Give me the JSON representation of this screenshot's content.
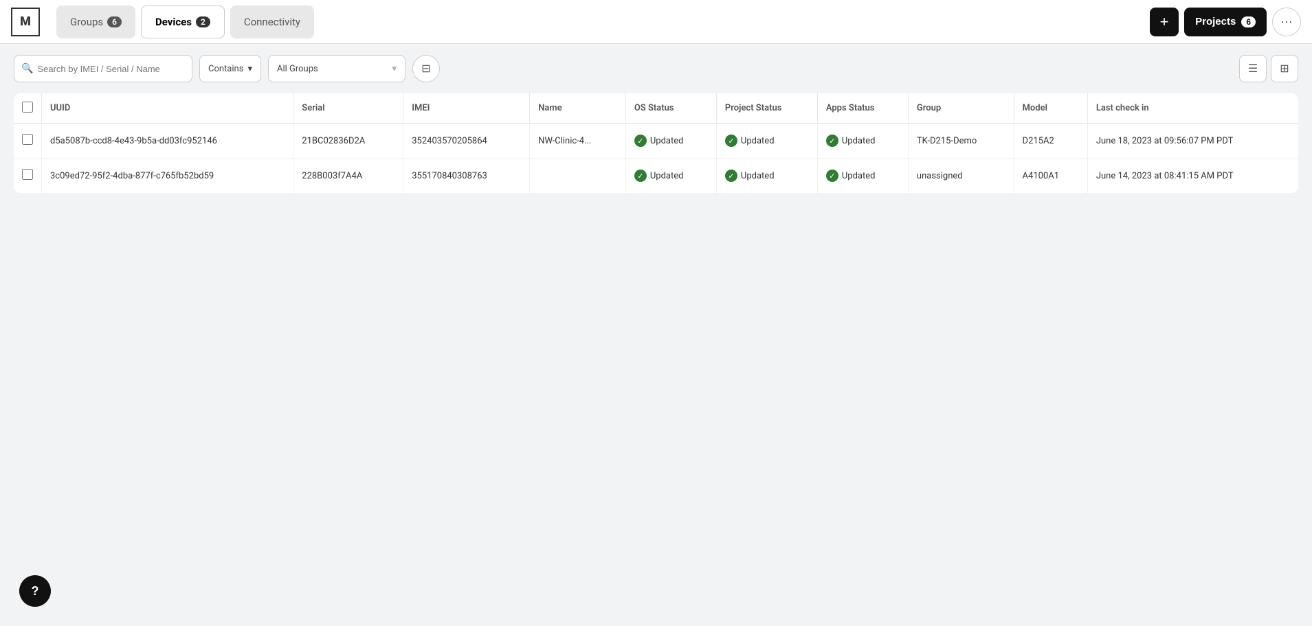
{
  "logo": "M",
  "tabs": [
    {
      "id": "groups",
      "label": "Groups",
      "badge": "6",
      "active": false
    },
    {
      "id": "devices",
      "label": "Devices",
      "badge": "2",
      "active": true
    },
    {
      "id": "connectivity",
      "label": "Connectivity",
      "badge": "",
      "active": false
    }
  ],
  "header": {
    "add_label": "+",
    "projects_label": "Projects",
    "projects_badge": "6",
    "more_dots": "···"
  },
  "toolbar": {
    "search_placeholder": "Search by IMEI / Serial / Name",
    "contains_label": "Contains",
    "all_groups_label": "All Groups",
    "filter_icon": "⊟"
  },
  "table": {
    "columns": [
      "UUID",
      "Serial",
      "IMEI",
      "Name",
      "OS Status",
      "Project Status",
      "Apps Status",
      "Group",
      "Model",
      "Last check in"
    ],
    "rows": [
      {
        "uuid": "d5a5087b-ccd8-4e43-9b5a-dd03fc952146",
        "serial": "21BC02836D2A",
        "imei": "352403570205864",
        "name": "NW-Clinic-4...",
        "os_status": "Updated",
        "project_status": "Updated",
        "apps_status": "Updated",
        "group": "TK-D215-Demo",
        "model": "D215A2",
        "last_check_in": "June 18, 2023 at 09:56:07 PM PDT"
      },
      {
        "uuid": "3c09ed72-95f2-4dba-877f-c765fb52bd59",
        "serial": "228B003f7A4A",
        "imei": "355170840308763",
        "name": "",
        "os_status": "Updated",
        "project_status": "Updated",
        "apps_status": "Updated",
        "group": "unassigned",
        "model": "A4100A1",
        "last_check_in": "June 14, 2023 at 08:41:15 AM PDT"
      }
    ]
  },
  "help_label": "?"
}
